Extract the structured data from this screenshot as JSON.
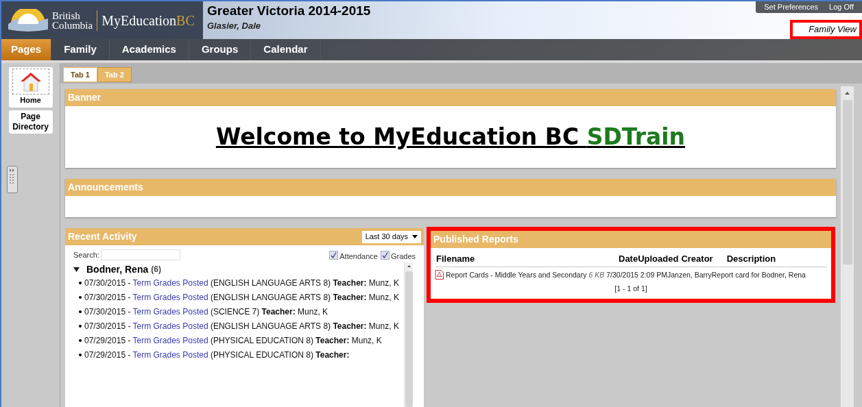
{
  "header": {
    "logo_line1": "British",
    "logo_line2": "Columbia",
    "brand": "MyEducation",
    "brand_suffix": "BC",
    "title": "Greater Victoria 2014-2015",
    "user": "Glasier, Dale",
    "links": [
      "Set Preferences",
      "Log Off"
    ],
    "view": "Family View",
    "view_highlighted": true
  },
  "nav": [
    {
      "label": "Pages",
      "selected": true
    },
    {
      "label": "Family",
      "selected": false
    },
    {
      "label": "Academics",
      "selected": false
    },
    {
      "label": "Groups",
      "selected": false
    },
    {
      "label": "Calendar",
      "selected": false
    }
  ],
  "sidebar": {
    "items": [
      "Home",
      "Page Directory"
    ]
  },
  "tabs": [
    {
      "label": "Tab 1",
      "selected": true
    },
    {
      "label": "Tab 2",
      "selected": false
    }
  ],
  "banner": {
    "title": "Banner",
    "text": "Welcome to MyEducation BC ",
    "highlight": "SDTrain"
  },
  "announcements": {
    "title": "Announcements"
  },
  "recent_activity": {
    "title": "Recent Activity",
    "range": "Last 30 days",
    "search_label": "Search:",
    "filters": [
      {
        "label": "Attendance",
        "checked": true
      },
      {
        "label": "Grades",
        "checked": true
      }
    ],
    "student": {
      "name": "Bodner, Rena",
      "count": "(6)",
      "expanded": true,
      "items": [
        {
          "date": "07/30/2015 - ",
          "link": "Term Grades Posted",
          "course": " (ENGLISH LANGUAGE ARTS 8) ",
          "teacher_label": "Teacher:",
          "teacher": " Munz, K"
        },
        {
          "date": "07/30/2015 - ",
          "link": "Term Grades Posted",
          "course": " (ENGLISH LANGUAGE ARTS 8) ",
          "teacher_label": "Teacher:",
          "teacher": " Munz, K"
        },
        {
          "date": "07/30/2015 - ",
          "link": "Term Grades Posted",
          "course": " (SCIENCE 7) ",
          "teacher_label": "Teacher:",
          "teacher": " Munz, K"
        },
        {
          "date": "07/30/2015 - ",
          "link": "Term Grades Posted",
          "course": " (ENGLISH LANGUAGE ARTS 8) ",
          "teacher_label": "Teacher:",
          "teacher": " Munz, K"
        },
        {
          "date": "07/29/2015 - ",
          "link": "Term Grades Posted",
          "course": " (PHYSICAL EDUCATION 8) ",
          "teacher_label": "Teacher:",
          "teacher": " Munz, K"
        },
        {
          "date": "07/29/2015 - ",
          "link": "Term Grades Posted",
          "course": " (PHYSICAL EDUCATION 8) ",
          "teacher_label": "Teacher:"
        }
      ]
    }
  },
  "published_reports": {
    "title": "Published Reports",
    "highlighted": true,
    "columns": [
      "Filename",
      "DateUploaded",
      "Creator",
      "Description"
    ],
    "rows": [
      {
        "filename": "Report Cards - Middle Years and Secondary",
        "size": "6 KB",
        "date": "7/30/2015 2:09 PM",
        "creator": "Janzen, Barry",
        "description": "Report card for Bodner, Rena"
      }
    ],
    "pager": "[1 - 1 of 1]"
  }
}
